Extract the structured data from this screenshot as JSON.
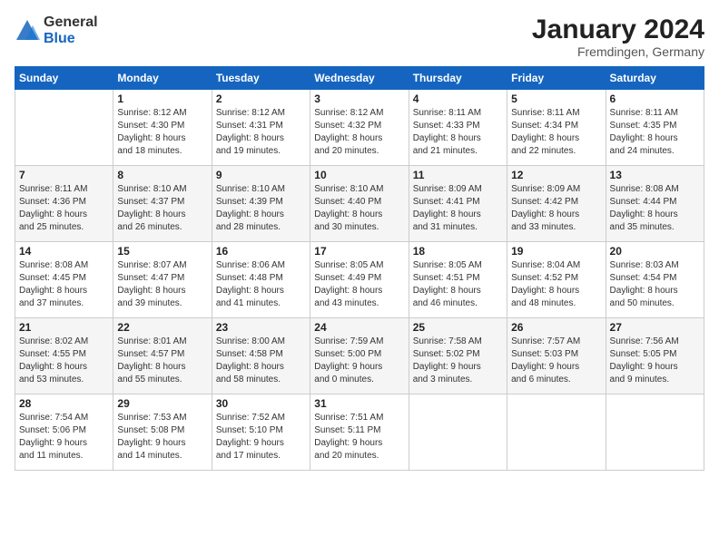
{
  "header": {
    "logo_general": "General",
    "logo_blue": "Blue",
    "month_title": "January 2024",
    "location": "Fremdingen, Germany"
  },
  "weekdays": [
    "Sunday",
    "Monday",
    "Tuesday",
    "Wednesday",
    "Thursday",
    "Friday",
    "Saturday"
  ],
  "weeks": [
    [
      {
        "day": "",
        "info": ""
      },
      {
        "day": "1",
        "info": "Sunrise: 8:12 AM\nSunset: 4:30 PM\nDaylight: 8 hours\nand 18 minutes."
      },
      {
        "day": "2",
        "info": "Sunrise: 8:12 AM\nSunset: 4:31 PM\nDaylight: 8 hours\nand 19 minutes."
      },
      {
        "day": "3",
        "info": "Sunrise: 8:12 AM\nSunset: 4:32 PM\nDaylight: 8 hours\nand 20 minutes."
      },
      {
        "day": "4",
        "info": "Sunrise: 8:11 AM\nSunset: 4:33 PM\nDaylight: 8 hours\nand 21 minutes."
      },
      {
        "day": "5",
        "info": "Sunrise: 8:11 AM\nSunset: 4:34 PM\nDaylight: 8 hours\nand 22 minutes."
      },
      {
        "day": "6",
        "info": "Sunrise: 8:11 AM\nSunset: 4:35 PM\nDaylight: 8 hours\nand 24 minutes."
      }
    ],
    [
      {
        "day": "7",
        "info": "Sunrise: 8:11 AM\nSunset: 4:36 PM\nDaylight: 8 hours\nand 25 minutes."
      },
      {
        "day": "8",
        "info": "Sunrise: 8:10 AM\nSunset: 4:37 PM\nDaylight: 8 hours\nand 26 minutes."
      },
      {
        "day": "9",
        "info": "Sunrise: 8:10 AM\nSunset: 4:39 PM\nDaylight: 8 hours\nand 28 minutes."
      },
      {
        "day": "10",
        "info": "Sunrise: 8:10 AM\nSunset: 4:40 PM\nDaylight: 8 hours\nand 30 minutes."
      },
      {
        "day": "11",
        "info": "Sunrise: 8:09 AM\nSunset: 4:41 PM\nDaylight: 8 hours\nand 31 minutes."
      },
      {
        "day": "12",
        "info": "Sunrise: 8:09 AM\nSunset: 4:42 PM\nDaylight: 8 hours\nand 33 minutes."
      },
      {
        "day": "13",
        "info": "Sunrise: 8:08 AM\nSunset: 4:44 PM\nDaylight: 8 hours\nand 35 minutes."
      }
    ],
    [
      {
        "day": "14",
        "info": "Sunrise: 8:08 AM\nSunset: 4:45 PM\nDaylight: 8 hours\nand 37 minutes."
      },
      {
        "day": "15",
        "info": "Sunrise: 8:07 AM\nSunset: 4:47 PM\nDaylight: 8 hours\nand 39 minutes."
      },
      {
        "day": "16",
        "info": "Sunrise: 8:06 AM\nSunset: 4:48 PM\nDaylight: 8 hours\nand 41 minutes."
      },
      {
        "day": "17",
        "info": "Sunrise: 8:05 AM\nSunset: 4:49 PM\nDaylight: 8 hours\nand 43 minutes."
      },
      {
        "day": "18",
        "info": "Sunrise: 8:05 AM\nSunset: 4:51 PM\nDaylight: 8 hours\nand 46 minutes."
      },
      {
        "day": "19",
        "info": "Sunrise: 8:04 AM\nSunset: 4:52 PM\nDaylight: 8 hours\nand 48 minutes."
      },
      {
        "day": "20",
        "info": "Sunrise: 8:03 AM\nSunset: 4:54 PM\nDaylight: 8 hours\nand 50 minutes."
      }
    ],
    [
      {
        "day": "21",
        "info": "Sunrise: 8:02 AM\nSunset: 4:55 PM\nDaylight: 8 hours\nand 53 minutes."
      },
      {
        "day": "22",
        "info": "Sunrise: 8:01 AM\nSunset: 4:57 PM\nDaylight: 8 hours\nand 55 minutes."
      },
      {
        "day": "23",
        "info": "Sunrise: 8:00 AM\nSunset: 4:58 PM\nDaylight: 8 hours\nand 58 minutes."
      },
      {
        "day": "24",
        "info": "Sunrise: 7:59 AM\nSunset: 5:00 PM\nDaylight: 9 hours\nand 0 minutes."
      },
      {
        "day": "25",
        "info": "Sunrise: 7:58 AM\nSunset: 5:02 PM\nDaylight: 9 hours\nand 3 minutes."
      },
      {
        "day": "26",
        "info": "Sunrise: 7:57 AM\nSunset: 5:03 PM\nDaylight: 9 hours\nand 6 minutes."
      },
      {
        "day": "27",
        "info": "Sunrise: 7:56 AM\nSunset: 5:05 PM\nDaylight: 9 hours\nand 9 minutes."
      }
    ],
    [
      {
        "day": "28",
        "info": "Sunrise: 7:54 AM\nSunset: 5:06 PM\nDaylight: 9 hours\nand 11 minutes."
      },
      {
        "day": "29",
        "info": "Sunrise: 7:53 AM\nSunset: 5:08 PM\nDaylight: 9 hours\nand 14 minutes."
      },
      {
        "day": "30",
        "info": "Sunrise: 7:52 AM\nSunset: 5:10 PM\nDaylight: 9 hours\nand 17 minutes."
      },
      {
        "day": "31",
        "info": "Sunrise: 7:51 AM\nSunset: 5:11 PM\nDaylight: 9 hours\nand 20 minutes."
      },
      {
        "day": "",
        "info": ""
      },
      {
        "day": "",
        "info": ""
      },
      {
        "day": "",
        "info": ""
      }
    ]
  ]
}
